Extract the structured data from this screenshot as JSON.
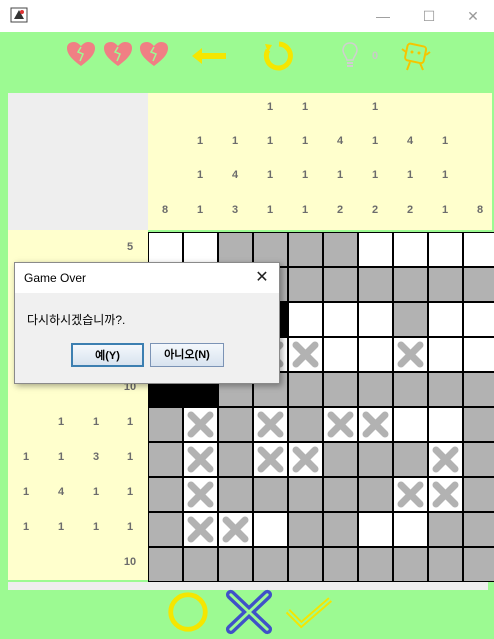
{
  "window": {
    "minimize_glyph": "—",
    "maximize_glyph": "☐",
    "close_glyph": "✕"
  },
  "toolbar": {
    "lives": 3,
    "undo_icon": "back-arrow-icon",
    "reset_icon": "refresh-icon",
    "hint_icon": "lightbulb-icon",
    "hint_count": "0",
    "character_icon": "character-icon"
  },
  "colors": {
    "background": "#9cfa92",
    "hint_background": "#ffffcd",
    "filled_cell": "#b2b2b2",
    "heart": "#f07f84",
    "accent_yellow": "#f5e600",
    "cross_blue": "#3f51c8"
  },
  "column_hints": [
    [
      "8"
    ],
    [
      "1",
      "1",
      "1"
    ],
    [
      "1",
      "4",
      "3"
    ],
    [
      "1",
      "1",
      "1",
      "1"
    ],
    [
      "1",
      "1",
      "1",
      "1"
    ],
    [
      "4",
      "1",
      "2"
    ],
    [
      "1",
      "1",
      "1",
      "2"
    ],
    [
      "4",
      "1",
      "2"
    ],
    [
      "1",
      "1",
      "1"
    ],
    [
      "8"
    ]
  ],
  "row_hints": [
    [
      "5"
    ],
    [],
    [],
    [],
    [
      "10"
    ],
    [
      "1",
      "1",
      "1"
    ],
    [
      "1",
      "1",
      "3",
      "1"
    ],
    [
      "1",
      "4",
      "1",
      "1"
    ],
    [
      "1",
      "1",
      "1",
      "1"
    ],
    [
      "10"
    ]
  ],
  "board": [
    "eeffffeeee",
    "..ffffffff",
    "..f.eeefee",
    "..fxxeexee",
    "..ffffffff",
    "fxfxfxxeef",
    "fxfxxfffxf",
    "fxfffffxxf",
    "fxxeffeeff",
    "ffffffffff"
  ],
  "bottom": {
    "confirm_icon": "circle-icon",
    "mark_icon": "cross-icon",
    "check_icon": "checkmark-icon"
  },
  "dialog": {
    "title": "Game Over",
    "message": "다시하시겠습니까?.",
    "yes_label": "예(Y)",
    "no_label": "아니오(N)"
  }
}
